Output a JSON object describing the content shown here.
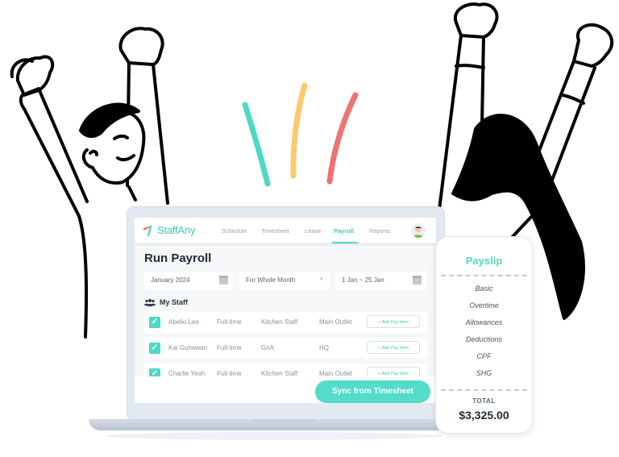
{
  "app": {
    "name": "StaffAny",
    "nav": [
      "Schedule",
      "Timesheet",
      "Leave",
      "Payroll",
      "Reports"
    ],
    "active_nav": "Payroll"
  },
  "page": {
    "title": "Run Payroll",
    "filters": {
      "month": "January 2024",
      "period": "For Whole Month",
      "date_range": "1 Jan ~ 25 Jan"
    },
    "section_title": "My Staff",
    "staff": [
      {
        "name": "Abelio Lee",
        "type": "Full-time",
        "role": "Kitchen Staff",
        "outlet": "Main Outlet",
        "action": "+ Add Pay Item",
        "checked": true
      },
      {
        "name": "Kai Gunawan",
        "type": "Full-time",
        "role": "GnA",
        "outlet": "HQ",
        "action": "+ Add Pay Item",
        "checked": true
      },
      {
        "name": "Charlie Yeoh",
        "type": "Full-time",
        "role": "Kitchen Staff",
        "outlet": "Main Outlet",
        "action": "+ Add Pay Item",
        "checked": true
      }
    ],
    "sync_button": "Sync from Timesheet"
  },
  "payslip": {
    "title": "Payslip",
    "items": [
      "Basic",
      "Overtime",
      "Allowances",
      "Deductions",
      "CPF",
      "SHG"
    ],
    "total_label": "TOTAL",
    "total_value": "$3,325.00"
  },
  "colors": {
    "accent": "#4fd8c7",
    "stroke_teal": "#4fd8c7",
    "stroke_yellow": "#fdc86e",
    "stroke_red": "#ee7373"
  }
}
